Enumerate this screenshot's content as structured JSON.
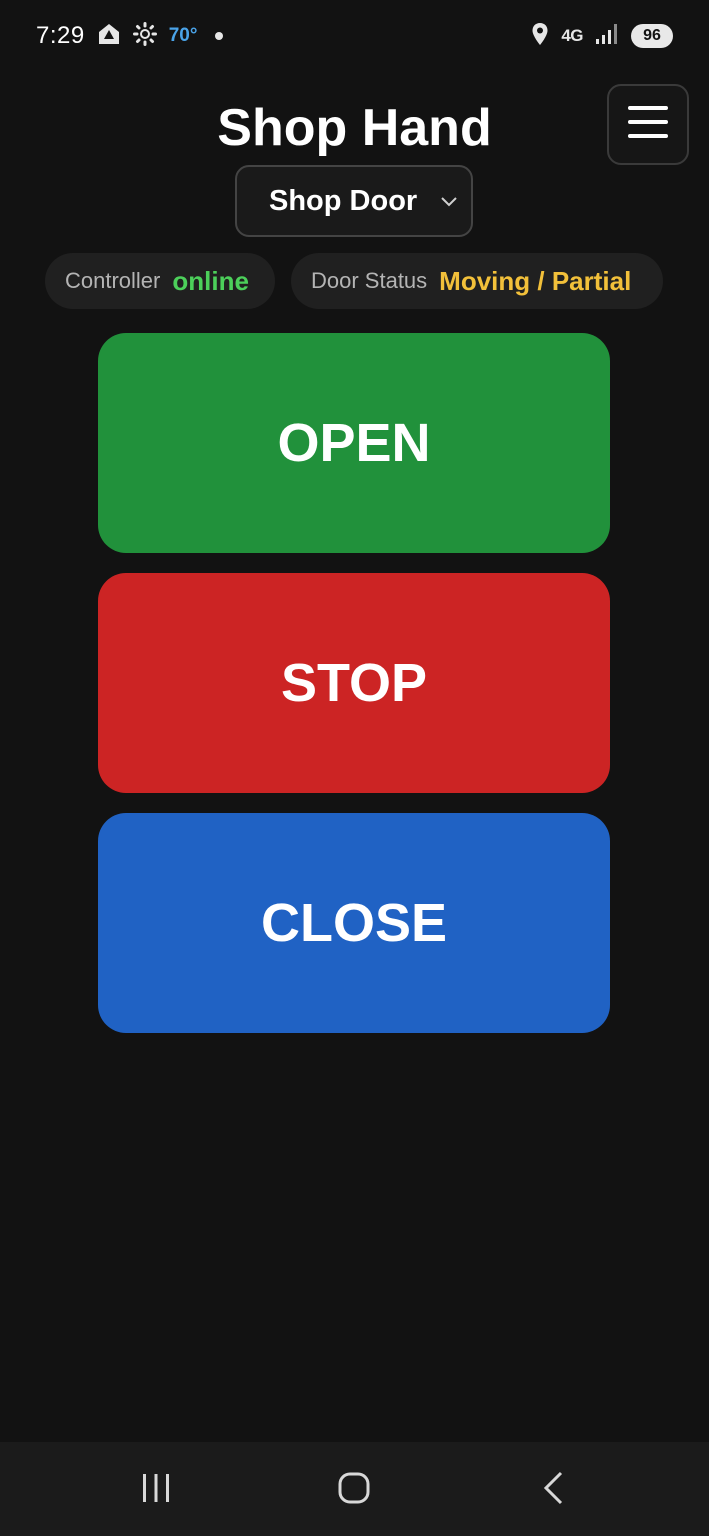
{
  "status_bar": {
    "time": "7:29",
    "weather": "70°",
    "network": "4G",
    "battery": "96"
  },
  "header": {
    "title": "Shop Hand",
    "menu_icon": "hamburger-menu-icon"
  },
  "door_selector": {
    "selected": "Shop Door"
  },
  "status": {
    "controller_label": "Controller",
    "controller_value": "online",
    "door_label": "Door Status",
    "door_value": "Moving / Partial"
  },
  "controls": {
    "open_label": "OPEN",
    "stop_label": "STOP",
    "close_label": "CLOSE"
  },
  "colors": {
    "background": "#121212",
    "open": "#21913b",
    "stop": "#cc2424",
    "close": "#2062c4",
    "online": "#4ccf5a",
    "moving": "#f2c03a"
  }
}
